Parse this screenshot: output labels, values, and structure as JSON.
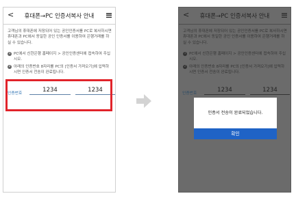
{
  "left_screen": {
    "title": "휴대폰→PC 인증서복사 안내",
    "back_glyph": "<",
    "intro": "고객님의 휴대폰에 저장되어 있는 공인인증서를 PC로 복사하시면 휴대폰과 PC에서 동일한 공인 인증서를 이용하여 은행거래를 하실 수 있습니다.",
    "steps": [
      {
        "num": "1",
        "text": "PC에서 신한은행 홈페이지 > 공인인증센터에 접속하여 주십시오."
      },
      {
        "num": "2",
        "text": "아래의 인증번호 8자리를 PC의 [인증서 가져오기]에 입력하시면 인증서 전송이 완료됩니다."
      }
    ],
    "code_label": "인증번호",
    "code_part1": "1234",
    "code_part2": "1234"
  },
  "right_screen": {
    "title": "휴대폰→PC 인증서복사 안내",
    "back_glyph": "<",
    "intro": "고객님의 휴대폰에 저장되어 있는 공인인증서를 PC로 복사하시면 휴대폰과 PC에서 동일한 공인 인증서를 이용하여 은행거래를 하실 수 있습니다.",
    "steps": [
      {
        "num": "1",
        "text": "PC에서 신한은행 홈페이지 > 공인인증센터에 접속하여 주십시오."
      },
      {
        "num": "2",
        "text": "아래의 인증번호 8자리를 PC의 [인증서 가져오기]에 입력하시면 인증서 전송이 완료됩니다."
      }
    ],
    "code_label": "인증번호",
    "code_part1": "1234",
    "code_part2": "1234",
    "dialog": {
      "message": "인증서 전송이 완료되었습니다.",
      "confirm_label": "확인"
    }
  },
  "icons": {
    "back": "chevron-left-icon",
    "menu": "hamburger-menu-icon",
    "arrow": "right-arrow-icon"
  },
  "colors": {
    "highlight": "#e1232a",
    "confirm_button": "#1f63c6",
    "code_label": "#2a6fb0",
    "overlay": "#6b6b6b"
  }
}
